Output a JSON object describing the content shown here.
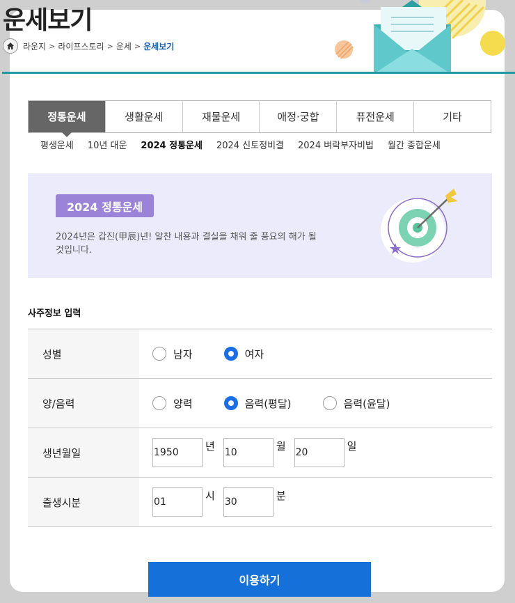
{
  "header": {
    "title": "운세보기",
    "breadcrumb": [
      "라운지",
      "라이프스토리",
      "운세",
      "운세보기"
    ]
  },
  "tabs": [
    {
      "label": "정통운세",
      "active": true
    },
    {
      "label": "생활운세"
    },
    {
      "label": "재물운세"
    },
    {
      "label": "애정·궁합"
    },
    {
      "label": "퓨전운세"
    },
    {
      "label": "기타"
    }
  ],
  "subtabs": [
    {
      "label": "평생운세"
    },
    {
      "label": "10년 대운"
    },
    {
      "label": "2024 정통운세",
      "active": true
    },
    {
      "label": "2024 신토정비결"
    },
    {
      "label": "2024 벼락부자비법"
    },
    {
      "label": "월간 종합운세"
    }
  ],
  "banner": {
    "badge": "2024 정통운세",
    "description": "2024년은 갑진(甲辰)년! 알찬 내용과 결실을 채워 줄 풍요의 해가 될 것입니다."
  },
  "form": {
    "section_title": "사주정보 입력",
    "gender": {
      "label": "성별",
      "options": [
        "남자",
        "여자"
      ],
      "selected": "여자"
    },
    "calendar": {
      "label": "양/음력",
      "options": [
        "양력",
        "음력(평달)",
        "음력(윤달)"
      ],
      "selected": "음력(평달)"
    },
    "birthdate": {
      "label": "생년월일",
      "year": "1950",
      "year_unit": "년",
      "month": "10",
      "month_unit": "월",
      "day": "20",
      "day_unit": "일"
    },
    "birthtime": {
      "label": "출생시분",
      "hour": "01",
      "hour_unit": "시",
      "minute": "30",
      "minute_unit": "분"
    }
  },
  "submit_label": "이용하기",
  "colors": {
    "accent": "#1670d9",
    "teal": "#1e9aa0",
    "badge": "#9b83d8",
    "banner_bg": "#ecebfc"
  }
}
